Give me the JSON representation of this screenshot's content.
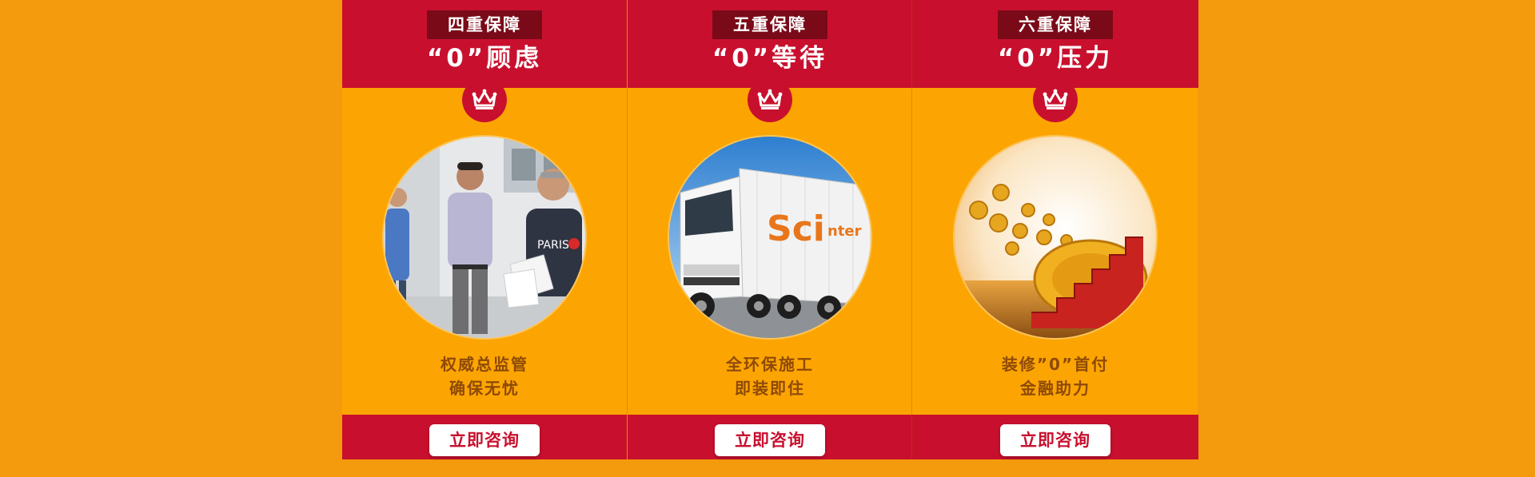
{
  "colors": {
    "page_bg": "#F39B0C",
    "panel_bg": "#FCA502",
    "brand_red": "#C8102E",
    "tag_bg": "#7A0A18",
    "desc_text": "#8E4A07"
  },
  "cards": [
    {
      "tag": "四重保障",
      "headline": "“0”顾虑",
      "icon": "crown-icon",
      "photo": "supervisors-inspecting-photo",
      "desc": [
        "权威总监管",
        "确保无忧"
      ],
      "cta": "立即咨询"
    },
    {
      "tag": "五重保障",
      "headline": "“0”等待",
      "icon": "crown-icon",
      "photo": "delivery-truck-photo",
      "truck_logo": "Sci",
      "truck_logo_suffix": "nter",
      "desc": [
        "全环保施工",
        "即装即住"
      ],
      "cta": "立即咨询"
    },
    {
      "tag": "六重保障",
      "headline": "“0”压力",
      "icon": "crown-icon",
      "photo": "gold-coins-staircase-photo",
      "desc": [
        "装修”0”首付",
        "金融助力"
      ],
      "cta": "立即咨询"
    }
  ]
}
